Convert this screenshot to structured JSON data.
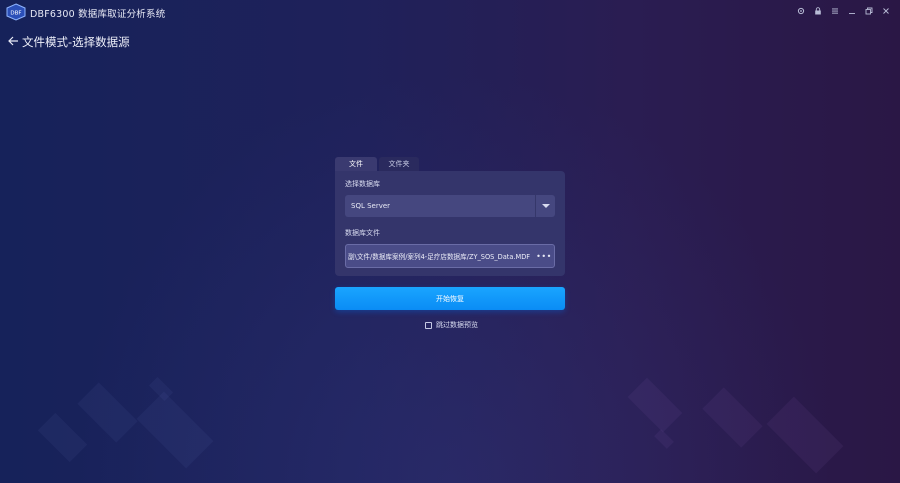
{
  "app": {
    "logo_text": "DBF",
    "title": "DBF6300 数据库取证分析系统"
  },
  "window_controls": [
    "settings-icon",
    "lock-icon",
    "menu-icon",
    "minimize-icon",
    "restore-icon",
    "close-icon"
  ],
  "header": {
    "title": "文件模式-选择数据源"
  },
  "tabs": [
    {
      "label": "文件",
      "active": true
    },
    {
      "label": "文件夹",
      "active": false
    }
  ],
  "form": {
    "db_label": "选择数据库",
    "db_value": "SQL Server",
    "file_label": "数据库文件",
    "file_path": "副\\文件/数据库案例/案列4-足疗店数据库/ZY_SOS_Data.MDF",
    "browse_label": "•••"
  },
  "start_button": "开始恢复",
  "skip_preview": {
    "label": "跳过数据预览",
    "checked": false
  },
  "colors": {
    "accent": "#0a8cf5",
    "panel": "#34356b"
  }
}
